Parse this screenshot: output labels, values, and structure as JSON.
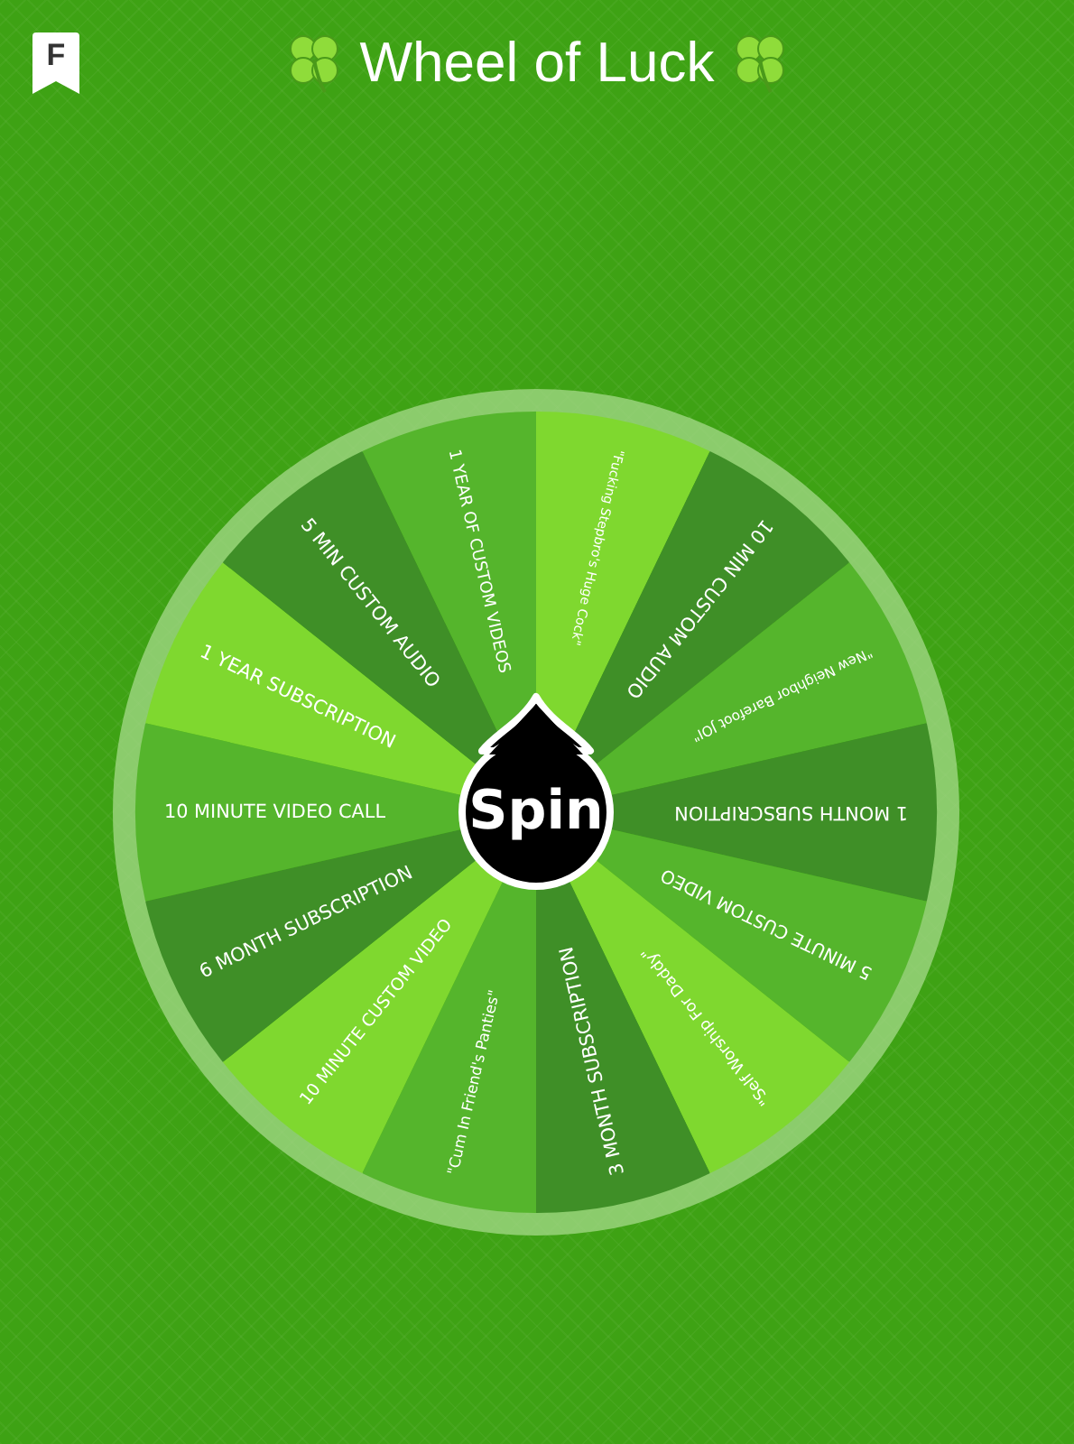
{
  "header": {
    "logo": "F",
    "title": "Wheel of Luck"
  },
  "wheel": {
    "button": "Spin",
    "segments": [
      {
        "label": "1 YEAR OF CUSTOM VIDEOS",
        "color": "#55b52c"
      },
      {
        "label": "\"Fucking Stepbro's Huge Cock\"",
        "color": "#7fd82f"
      },
      {
        "label": "10 MIN CUSTOM AUDIO",
        "color": "#3f8f27"
      },
      {
        "label": "\"New Neighbor Barefoot JOI\"",
        "color": "#55b52c"
      },
      {
        "label": "1 MONTH SUBSCRIPTION",
        "color": "#3f8f27"
      },
      {
        "label": "5 MINUTE CUSTOM VIDEO",
        "color": "#55b52c"
      },
      {
        "label": "\"Self Worship For Daddy\"",
        "color": "#7fd82f"
      },
      {
        "label": "3 MONTH SUBSCRIPTION",
        "color": "#3f8f27"
      },
      {
        "label": "\"Cum In Friend's Panties\"",
        "color": "#55b52c"
      },
      {
        "label": "10 MINUTE CUSTOM VIDEO",
        "color": "#7fd82f"
      },
      {
        "label": "6 MONTH SUBSCRIPTION",
        "color": "#3f8f27"
      },
      {
        "label": "10 MINUTE VIDEO CALL",
        "color": "#55b52c"
      },
      {
        "label": "1 YEAR SUBSCRIPTION",
        "color": "#7fd82f"
      },
      {
        "label": "5 MIN CUSTOM AUDIO",
        "color": "#3f8f27"
      }
    ]
  }
}
